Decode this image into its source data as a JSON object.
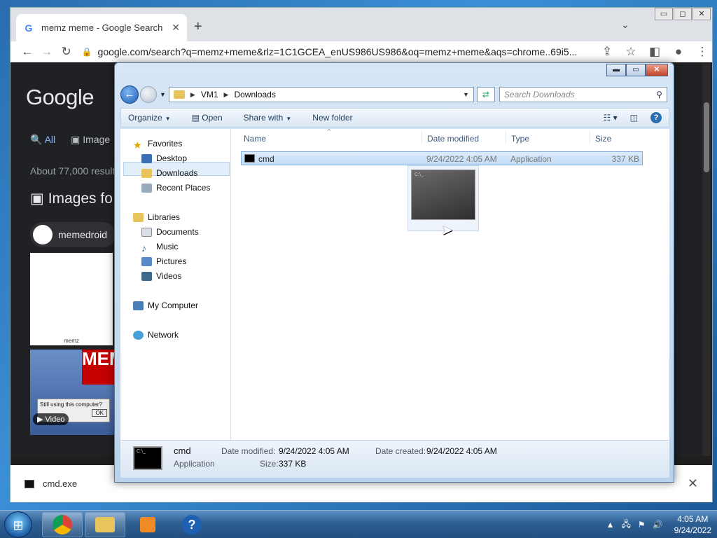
{
  "chrome": {
    "tab_title": "memz meme - Google Search",
    "tab_close": "✕",
    "new_tab": "+",
    "tab_menu": "⌄",
    "win_buttons": [
      "▭",
      "◻",
      "✕"
    ],
    "url": "google.com/search?q=memz+meme&rlz=1C1GCEA_enUS986US986&oq=memz+meme&aqs=chrome..69i5...",
    "nav": {
      "back": "←",
      "forward": "→",
      "reload": "↻"
    },
    "toolbar_right": {
      "share": "⇪",
      "star": "☆",
      "sidepanel": "◧",
      "profile": "●",
      "menu": "⋮"
    },
    "content": {
      "logo": "Google",
      "tabs": {
        "all": "All",
        "images": "Image"
      },
      "result_stats": "About 77,000 result",
      "images_heading": "Images fo",
      "chip": "memedroid",
      "thumb1_caption": "memz",
      "thumb2_text": "MEM",
      "thumb2_dialog": "Still using this computer?",
      "thumb2_ok": "OK",
      "video_badge": "Video"
    },
    "download": {
      "filename": "cmd.exe",
      "close": "✕"
    }
  },
  "explorer": {
    "win_buttons": {
      "minimize": "▬",
      "maximize": "▭",
      "close": "✕"
    },
    "breadcrumb": [
      "VM1",
      "Downloads"
    ],
    "search_placeholder": "Search Downloads",
    "commands": {
      "organize": "Organize",
      "open": "Open",
      "share_with": "Share with",
      "new_folder": "New folder"
    },
    "nav_pane": {
      "favorites": "Favorites",
      "desktop": "Desktop",
      "downloads": "Downloads",
      "recent_places": "Recent Places",
      "libraries": "Libraries",
      "documents": "Documents",
      "music": "Music",
      "pictures": "Pictures",
      "videos": "Videos",
      "my_computer": "My Computer",
      "network": "Network"
    },
    "columns": {
      "name": "Name",
      "date_modified": "Date modified",
      "type": "Type",
      "size": "Size"
    },
    "files": [
      {
        "name": "cmd",
        "date_modified": "9/24/2022 4:05 AM",
        "type": "Application",
        "size": "337 KB"
      }
    ],
    "details": {
      "name": "cmd",
      "type": "Application",
      "date_modified_label": "Date modified:",
      "date_modified": "9/24/2022 4:05 AM",
      "size_label": "Size:",
      "size": "337 KB",
      "date_created_label": "Date created:",
      "date_created": "9/24/2022 4:05 AM"
    }
  },
  "taskbar": {
    "time": "4:05 AM",
    "date": "9/24/2022",
    "help": "?"
  },
  "colors": {
    "accent": "#2a6db0",
    "selection": "#c2dcf6",
    "google_dark": "#202124",
    "link_blue": "#8ab4f8"
  }
}
